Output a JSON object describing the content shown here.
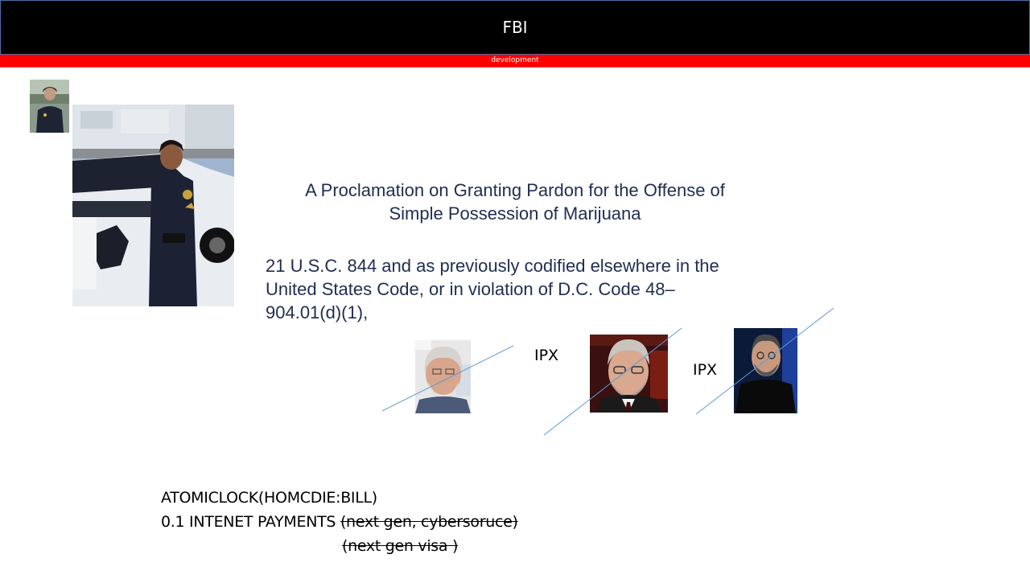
{
  "header": {
    "title": "FBI",
    "subtitle": "development"
  },
  "images": {
    "small_officer": "officer-photo-small",
    "officer_car": "officer-with-patrol-car-photo",
    "person_1": "person-photo-1",
    "person_2": "person-photo-2",
    "person_3": "person-photo-3"
  },
  "main": {
    "title_line1": "A Proclamation on Granting Pardon for the Offense of",
    "title_line2": "Simple Possession of Marijuana",
    "code_line1": "21 U.S.C. 844 and as previously codified elsewhere in the",
    "code_line2": "United States Code, or in violation of D.C. Code 48–",
    "code_line3": "904.01(d)(1),"
  },
  "labels": {
    "ipx_1": "IPX",
    "ipx_2": "IPX"
  },
  "footer": {
    "line1": "ATOMICLOCK(HOMCDIE:BILL)",
    "line2_prefix": "0.1 INTENET PAYMENTS ",
    "line2_struck": "(next gen, cybersoruce)",
    "line3_struck": "(next gen visa )"
  },
  "colors": {
    "header_bg": "#000000",
    "accent_red": "#ff0000",
    "body_text": "#1f2d50",
    "line_blue": "#5b9bd5"
  }
}
